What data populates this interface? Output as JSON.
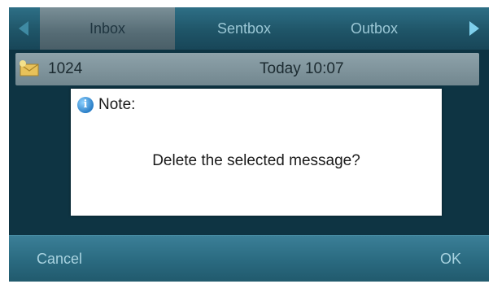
{
  "tabs": [
    {
      "label": "Inbox"
    },
    {
      "label": "Sentbox"
    },
    {
      "label": "Outbox"
    }
  ],
  "message": {
    "sender": "1024",
    "time": "Today 10:07"
  },
  "dialog": {
    "title": "Note:",
    "text": "Delete the selected message?"
  },
  "softkeys": {
    "cancel": "Cancel",
    "ok": "OK"
  },
  "colors": {
    "screen_bg": "#0e3443",
    "tab_active": "#566c75",
    "softkey_bar": "#2a6a80"
  }
}
